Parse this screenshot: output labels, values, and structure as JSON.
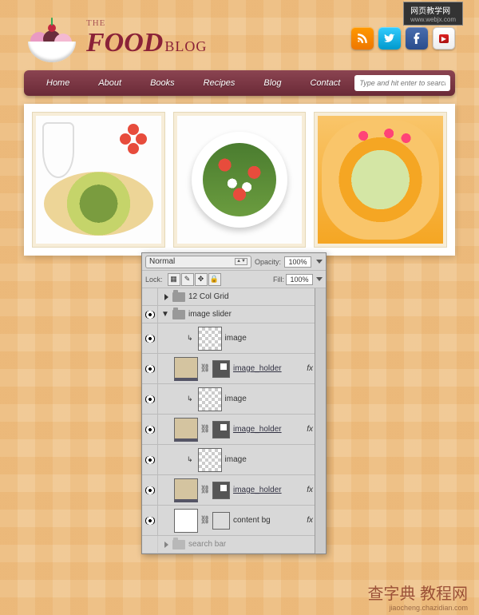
{
  "top_badge": "网页教学网",
  "top_badge_url": "www.webjx.com",
  "logo": {
    "the": "THE",
    "food": "FOOD",
    "blog": "BLOG"
  },
  "social": {
    "rss": "rss",
    "twitter": "twitter",
    "facebook": "facebook",
    "youtube": "YouTube"
  },
  "nav": {
    "items": [
      "Home",
      "About",
      "Books",
      "Recipes",
      "Blog",
      "Contact"
    ],
    "search_placeholder": "Type and hit enter to search"
  },
  "layers_panel": {
    "blend_mode": "Normal",
    "opacity_label": "Opacity:",
    "opacity_value": "100%",
    "lock_label": "Lock:",
    "fill_label": "Fill:",
    "fill_value": "100%",
    "rows": [
      {
        "eye": false,
        "type": "group",
        "open": false,
        "indent": 0,
        "name": "12 Col Grid"
      },
      {
        "eye": true,
        "type": "group",
        "open": true,
        "indent": 0,
        "name": "image slider"
      },
      {
        "eye": true,
        "type": "image",
        "indent": 2,
        "name": "image",
        "clip": true
      },
      {
        "eye": true,
        "type": "holder",
        "indent": 1,
        "name": "image_holder",
        "fx": true
      },
      {
        "eye": true,
        "type": "image",
        "indent": 2,
        "name": "image",
        "clip": true
      },
      {
        "eye": true,
        "type": "holder",
        "indent": 1,
        "name": "image_holder",
        "fx": true
      },
      {
        "eye": true,
        "type": "image",
        "indent": 2,
        "name": "image",
        "clip": true
      },
      {
        "eye": true,
        "type": "holder",
        "indent": 1,
        "name": "image_holder",
        "fx": true
      },
      {
        "eye": true,
        "type": "bg",
        "indent": 1,
        "name": "content bg",
        "fx": true
      },
      {
        "eye": false,
        "type": "group",
        "open": false,
        "indent": 0,
        "name": "search bar",
        "faded": true
      }
    ]
  },
  "watermark": {
    "main": "查字典 教程网",
    "sub": "jiaocheng.chazidian.com"
  }
}
